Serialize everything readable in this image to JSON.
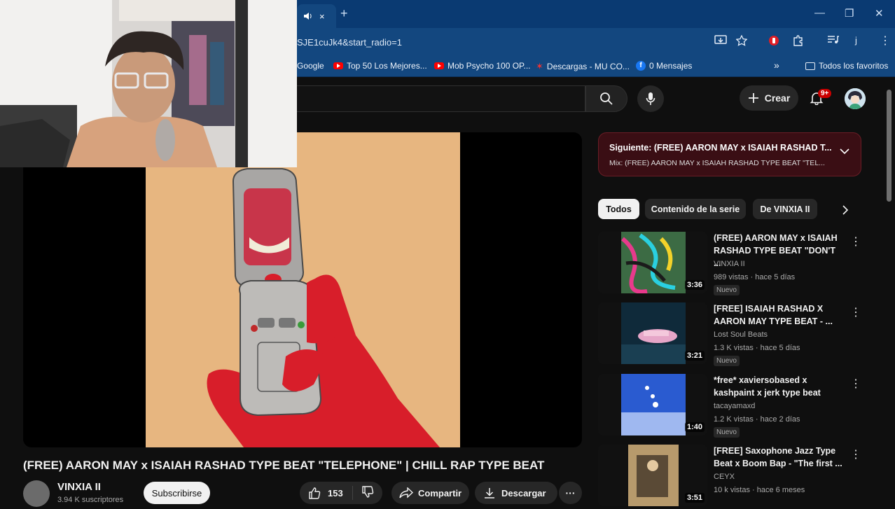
{
  "browser": {
    "url": "SJE1cuJk4&start_radio=1",
    "bookmarks": [
      {
        "label": "Google",
        "icon": "google-icon"
      },
      {
        "label": "Top 50 Los Mejores...",
        "icon": "youtube-icon"
      },
      {
        "label": "Mob Psycho 100 OP...",
        "icon": "youtube-icon"
      },
      {
        "label": "Descargas - MU CO...",
        "icon": "mu-icon"
      },
      {
        "label": "0 Mensajes",
        "icon": "facebook-icon"
      }
    ],
    "favorites_label": "Todos los favoritos",
    "chevron": "»",
    "tab_close": "×",
    "new_tab": "+",
    "win_min": "—",
    "win_max": "❐",
    "win_close": "✕"
  },
  "youtube": {
    "create_label": "Crear",
    "notif_badge": "9+"
  },
  "video": {
    "title": "(FREE) AARON MAY x ISAIAH RASHAD TYPE BEAT \"TELEPHONE\" | CHILL RAP TYPE BEAT",
    "channel": "VINXIA II",
    "subscribers": "3.94 K suscriptores",
    "subscribe_label": "Subscribirse",
    "likes": "153",
    "share_label": "Compartir",
    "download_label": "Descargar",
    "more": "···"
  },
  "playlist": {
    "next_label": "Siguiente: (FREE) AARON MAY x ISAIAH RASHAD T...",
    "mix_label": "Mix: (FREE) AARON MAY x ISAIAH RASHAD TYPE BEAT \"TEL..."
  },
  "chips": [
    "Todos",
    "Contenido de la serie",
    "De VINXIA II"
  ],
  "recommendations": [
    {
      "title": "(FREE) AARON MAY x ISAIAH RASHAD TYPE BEAT \"DON'T ...",
      "channel": "VINXIA II",
      "meta": "989 vistas · hace 5 días",
      "badge": "Nuevo",
      "duration": "3:36"
    },
    {
      "title": "[FREE] ISAIAH RASHAD X AARON MAY TYPE BEAT - ...",
      "channel": "Lost Soul Beats",
      "meta": "1.3 K vistas · hace 5 días",
      "badge": "Nuevo",
      "duration": "3:21"
    },
    {
      "title": "*free* xaviersobased x kashpaint x jerk type beat",
      "channel": "tacayamaxd",
      "meta": "1.2 K vistas · hace 2 días",
      "badge": "Nuevo",
      "duration": "1:40"
    },
    {
      "title": "[FREE] Saxophone Jazz Type Beat x Boom Bap - \"The first ...",
      "channel": "CEYX",
      "meta": "10 k vistas · hace 6 meses",
      "badge": "",
      "duration": "3:51"
    }
  ],
  "colors": {
    "accent_red": "#cc0000",
    "browser_blue": "#13477f",
    "next_bg": "#3a0e14"
  }
}
